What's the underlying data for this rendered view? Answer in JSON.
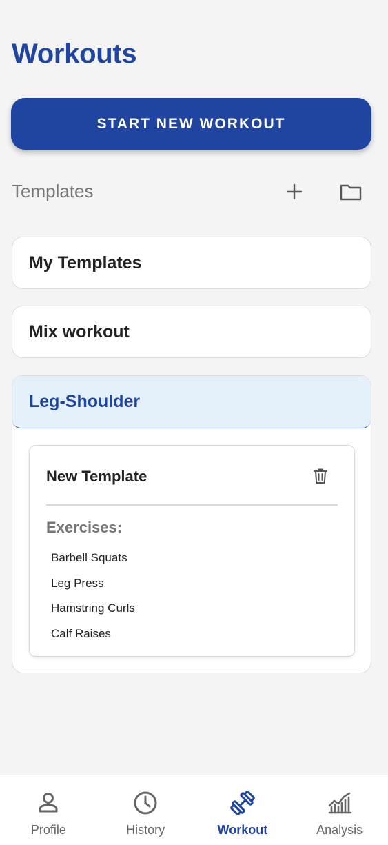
{
  "header": {
    "title": "Workouts"
  },
  "start_button": {
    "label": "START NEW WORKOUT"
  },
  "templates": {
    "section_label": "Templates",
    "add_icon": "plus-icon",
    "folder_icon": "folder-icon"
  },
  "folders": [
    {
      "name": "My Templates",
      "expanded": false
    },
    {
      "name": "Mix workout",
      "expanded": false
    },
    {
      "name": "Leg-Shoulder",
      "expanded": true
    }
  ],
  "expanded_folder": {
    "template": {
      "name": "New Template",
      "delete_icon": "trash-icon",
      "exercises_label": "Exercises:",
      "exercises": [
        "Barbell Squats",
        "Leg Press",
        "Hamstring Curls",
        "Calf Raises"
      ]
    }
  },
  "bottom_nav": {
    "items": [
      {
        "label": "Profile",
        "icon": "person-icon",
        "active": false
      },
      {
        "label": "History",
        "icon": "clock-icon",
        "active": false
      },
      {
        "label": "Workout",
        "icon": "dumbbell-icon",
        "active": true
      },
      {
        "label": "Analysis",
        "icon": "chart-icon",
        "active": false
      }
    ]
  },
  "colors": {
    "accent": "#1f45a0",
    "background": "#f4f4f4",
    "expanded_folder_bg": "#e4f0fa",
    "muted_text": "#777777"
  }
}
